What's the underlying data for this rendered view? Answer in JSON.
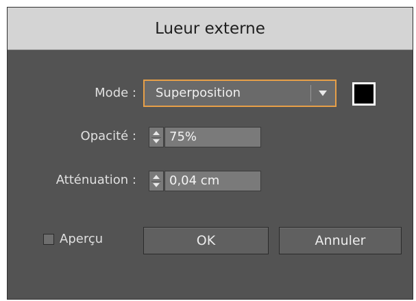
{
  "dialog": {
    "title": "Lueur externe"
  },
  "mode": {
    "label": "Mode :",
    "selected": "Superposition",
    "color": "#000000"
  },
  "opacity": {
    "label": "Opacité :",
    "value": "75%"
  },
  "blur": {
    "label": "Atténuation :",
    "value": "0,04 cm"
  },
  "preview": {
    "label": "Aperçu",
    "checked": false
  },
  "buttons": {
    "ok": "OK",
    "cancel": "Annuler"
  },
  "icons": {
    "dropdown": "chevron-down-icon",
    "spin": "spin-arrows-icon",
    "checkbox": "checkbox-icon"
  }
}
